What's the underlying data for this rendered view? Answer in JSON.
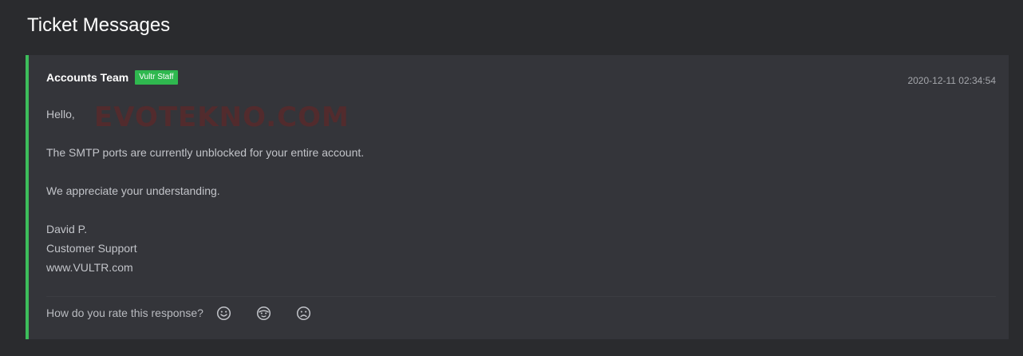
{
  "section": {
    "title": "Ticket Messages"
  },
  "message": {
    "author": "Accounts Team",
    "badge": "Vultr Staff",
    "timestamp": "2020-12-11 02:34:54",
    "body": {
      "greeting": "Hello,",
      "line1": "The SMTP ports are currently unblocked for your entire account.",
      "line2": "We appreciate your understanding.",
      "signature": [
        "David P.",
        "Customer Support",
        "www.VULTR.com"
      ]
    },
    "watermark": "EVOTEKNO.COM"
  },
  "rating": {
    "question": "How do you rate this response?",
    "options": [
      {
        "icon": "smile-face-icon"
      },
      {
        "icon": "neutral-face-icon"
      },
      {
        "icon": "sad-face-icon"
      }
    ]
  },
  "colors": {
    "background": "#2a2b2e",
    "card": "#34353a",
    "accent": "#3dbd5b",
    "badge": "#2fb84f",
    "text": "#c2c4c9"
  }
}
